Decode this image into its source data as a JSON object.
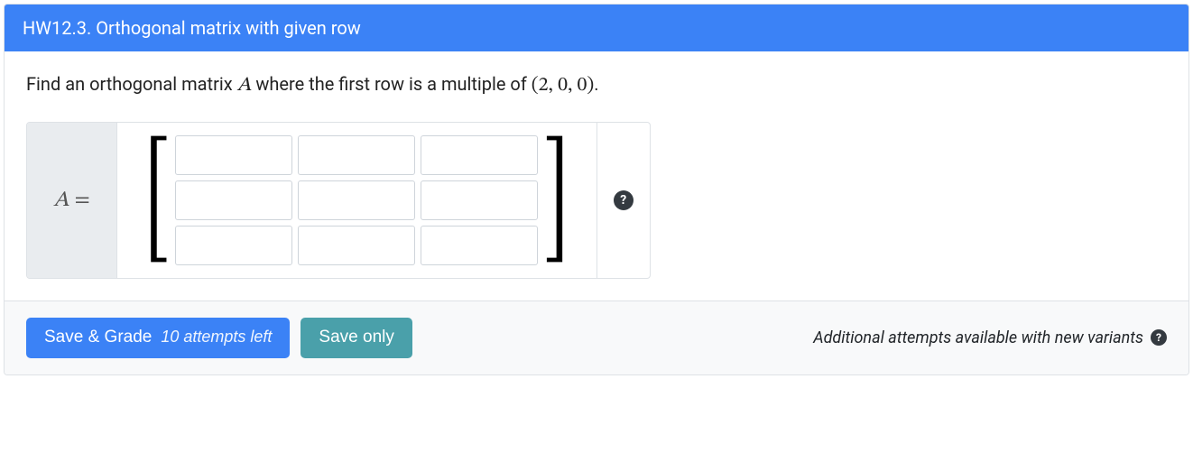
{
  "header": {
    "title": "HW12.3. Orthogonal matrix with given row"
  },
  "prompt": {
    "prefix": "Find an orthogonal matrix ",
    "variable": "A",
    "middle": " where the first row is a multiple of ",
    "vector": "(2, 0, 0)",
    "suffix": "."
  },
  "matrix": {
    "label_variable": "A",
    "label_eq": "=",
    "rows": 3,
    "cols": 3,
    "values": [
      [
        "",
        "",
        ""
      ],
      [
        "",
        "",
        ""
      ],
      [
        "",
        "",
        ""
      ]
    ]
  },
  "help": {
    "glyph": "?"
  },
  "footer": {
    "save_grade_label": "Save & Grade",
    "attempts_text": "10 attempts left",
    "save_only_label": "Save only",
    "footnote": "Additional attempts available with new variants",
    "footnote_help_glyph": "?"
  }
}
